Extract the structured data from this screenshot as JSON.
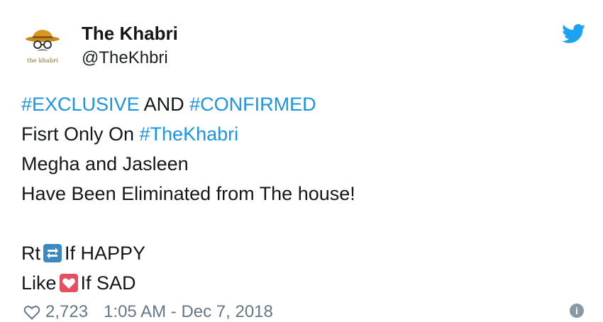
{
  "tweet": {
    "author": {
      "display_name": "The Khabri",
      "handle": "@TheKhbri",
      "avatar_label": "the khabri",
      "avatar_icon": "detective-hat-icon"
    },
    "platform_icon": "twitter-bird-icon",
    "lines": {
      "l1_tag1": "#EXCLUSIVE",
      "l1_mid": " AND ",
      "l1_tag2": "#CONFIRMED",
      "l2_text": "Fisrt Only On ",
      "l2_tag": "#TheKhabri",
      "l3": "Megha and Jasleen",
      "l4": "Have Been Eliminated from The house!",
      "l5_pre": "Rt",
      "l5_post": "If HAPPY",
      "l6_pre": "Like",
      "l6_post": "If SAD"
    },
    "emojis": {
      "retweet": "retweet-emoji-icon",
      "heart": "red-heart-emoji-icon"
    },
    "footer": {
      "likes": "2,723",
      "timestamp": "1:05 AM - Dec 7, 2018",
      "info_icon": "info-icon"
    },
    "colors": {
      "hashtag": "#1b95e0",
      "twitter_blue": "#1da1f2",
      "muted": "#657786"
    }
  }
}
